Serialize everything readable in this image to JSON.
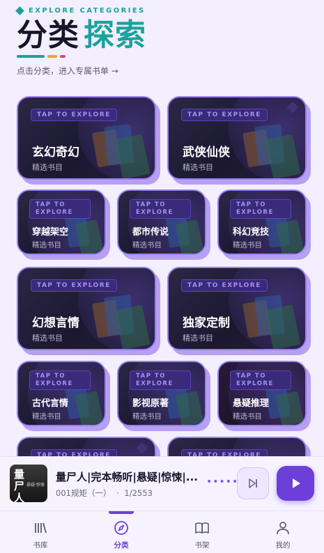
{
  "header": {
    "eyebrow": "EXPLORE CATEGORIES",
    "title_part1": "分类",
    "title_part2": "探索",
    "subtitle": "点击分类，进入专属书单 →",
    "accent_color": "#1aa39c",
    "underline_colors": [
      "#1aa39c",
      "#e0a93a",
      "#d24a8a"
    ]
  },
  "categories": [
    {
      "tag": "TAP TO EXPLORE",
      "name": "玄幻奇幻",
      "sub": "精选书目"
    },
    {
      "tag": "TAP TO EXPLORE",
      "name": "武侠仙侠",
      "sub": "精选书目"
    },
    {
      "tag": "TAP TO EXPLORE",
      "name": "穿越架空",
      "sub": "精选书目"
    },
    {
      "tag": "TAP TO EXPLORE",
      "name": "都市传说",
      "sub": "精选书目"
    },
    {
      "tag": "TAP TO EXPLORE",
      "name": "科幻竞技",
      "sub": "精选书目"
    },
    {
      "tag": "TAP TO EXPLORE",
      "name": "幻想言情",
      "sub": "精选书目"
    },
    {
      "tag": "TAP TO EXPLORE",
      "name": "独家定制",
      "sub": "精选书目"
    },
    {
      "tag": "TAP TO EXPLORE",
      "name": "古代言情",
      "sub": "精选书目"
    },
    {
      "tag": "TAP TO EXPLORE",
      "name": "影视原著",
      "sub": "精选书目"
    },
    {
      "tag": "TAP TO EXPLORE",
      "name": "悬疑推理",
      "sub": "精选书目"
    },
    {
      "tag": "TAP TO EXPLORE",
      "name": "",
      "sub": ""
    },
    {
      "tag": "TAP TO EXPLORE",
      "name": "",
      "sub": ""
    }
  ],
  "player": {
    "cover_title": "量尸人",
    "cover_sub": "悬疑·惊悚",
    "title": "量尸人|完本畅听|悬疑|惊悚|...",
    "episode": "001规矩（一）",
    "separator": "·",
    "progress": "1/2553",
    "more": "•••••",
    "accent_color": "#6c3fd8"
  },
  "nav": {
    "items": [
      {
        "label": "书库",
        "icon": "library-icon"
      },
      {
        "label": "分类",
        "icon": "compass-icon",
        "active": true
      },
      {
        "label": "书架",
        "icon": "book-open-icon"
      },
      {
        "label": "我的",
        "icon": "user-icon"
      }
    ]
  }
}
